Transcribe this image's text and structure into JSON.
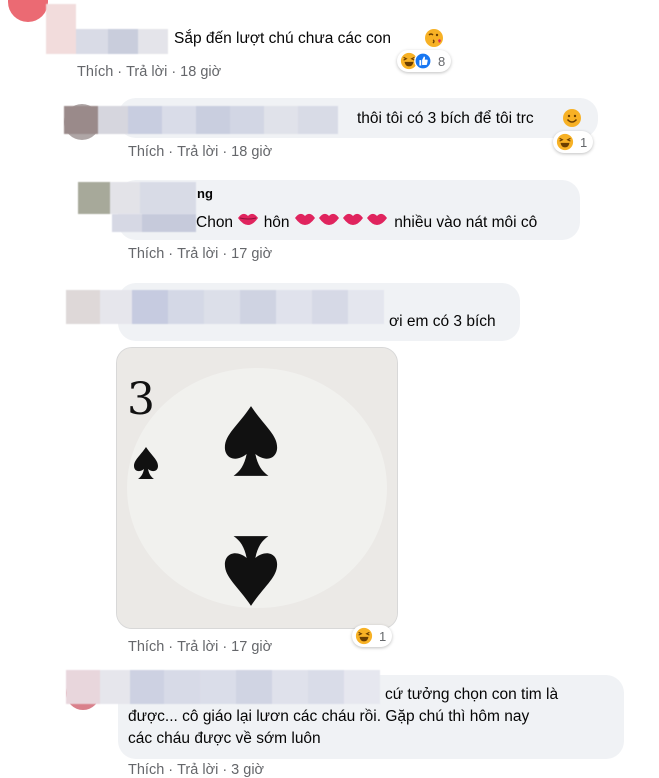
{
  "comments": [
    {
      "text": "Sắp đến lượt chú chưa các con",
      "like": "Thích",
      "reply": "Trả lời",
      "time": "18 giờ",
      "reaction_count": "8"
    },
    {
      "text": "thôi tôi có 3 bích để tôi trc",
      "like": "Thích",
      "reply": "Trả lời",
      "time": "18 giờ",
      "reaction_count": "1"
    },
    {
      "name_partial": "ng",
      "text_a": "Chon",
      "text_b": "hôn",
      "text_c": "nhiều vào nát môi cô",
      "like": "Thích",
      "reply": "Trả lời",
      "time": "17 giờ"
    },
    {
      "text": "ơi em có 3 bích",
      "like": "Thích",
      "reply": "Trả lời",
      "time": "17 giờ",
      "reaction_count": "1",
      "card": {
        "rank": "3"
      }
    },
    {
      "line1": "cứ tưởng chọn con tim là",
      "line2": "được... cô giáo lại lươn các cháu rồi. Gặp chú thì hôm nay",
      "line3": "các cháu được về sớm luôn",
      "like": "Thích",
      "reply": "Trả lời",
      "time": "3 giờ"
    }
  ],
  "icons": {
    "haha": "haha-emoji",
    "like": "like-reaction",
    "kiss": "kiss-emoji",
    "smile": "smile-emoji",
    "lips": "kiss-mark"
  },
  "colors": {
    "bubble": "#f0f2f5",
    "meta": "#65676b",
    "haha": "#f7b125",
    "like": "#1877f2",
    "lips": "#e0245e"
  }
}
